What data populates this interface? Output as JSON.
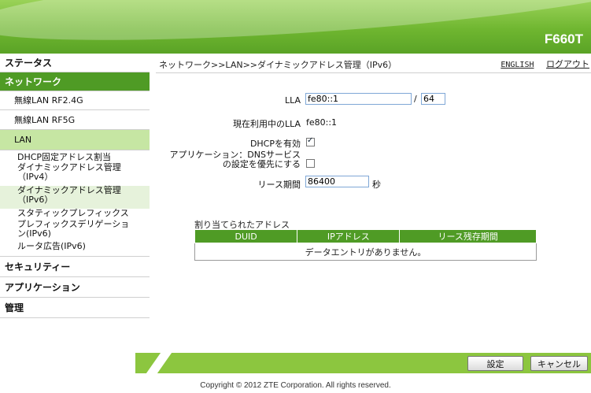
{
  "header": {
    "model": "F660T"
  },
  "sidebar": {
    "status": "ステータス",
    "network": "ネットワーク",
    "wlan24": "無線LAN RF2.4G",
    "wlan5": "無線LAN RF5G",
    "lan": "LAN",
    "lan_items": [
      "DHCP固定アドレス割当",
      "ダイナミックアドレス管理\n（IPv4）",
      "ダイナミックアドレス管理\n（IPv6）",
      "スタティックプレフィックス",
      "プレフィックスデリゲーショ\nン(IPv6)",
      "ルータ広告(IPv6)"
    ],
    "security": "セキュリティー",
    "application": "アプリケーション",
    "admin": "管理"
  },
  "topbar": {
    "breadcrumb": "ネットワーク>>LAN>>ダイナミックアドレス管理（IPv6）",
    "english": "ENGLISH",
    "logout": "ログアウト"
  },
  "form": {
    "lla_label": "LLA",
    "lla_value": "fe80::1",
    "slash": "/",
    "prefix_len": "64",
    "current_lla_label": "現在利用中のLLA",
    "current_lla_value": "fe80::1",
    "dhcp_label": "DHCPを有効",
    "dhcp_checked": true,
    "dns_label_line1": "アプリケーション：DNSサービス",
    "dns_label_line2": "の設定を優先にする",
    "dns_checked": false,
    "lease_label": "リース期間",
    "lease_value": "86400",
    "lease_unit": "秒"
  },
  "assigned": {
    "title": "割り当てられたアドレス",
    "columns": [
      "DUID",
      "IPアドレス",
      "リース残存期間"
    ],
    "empty_message": "データエントリがありません。"
  },
  "footer": {
    "apply": "設定",
    "cancel": "キャンセル",
    "copyright": "Copyright © 2012 ZTE Corporation. All rights reserved."
  }
}
